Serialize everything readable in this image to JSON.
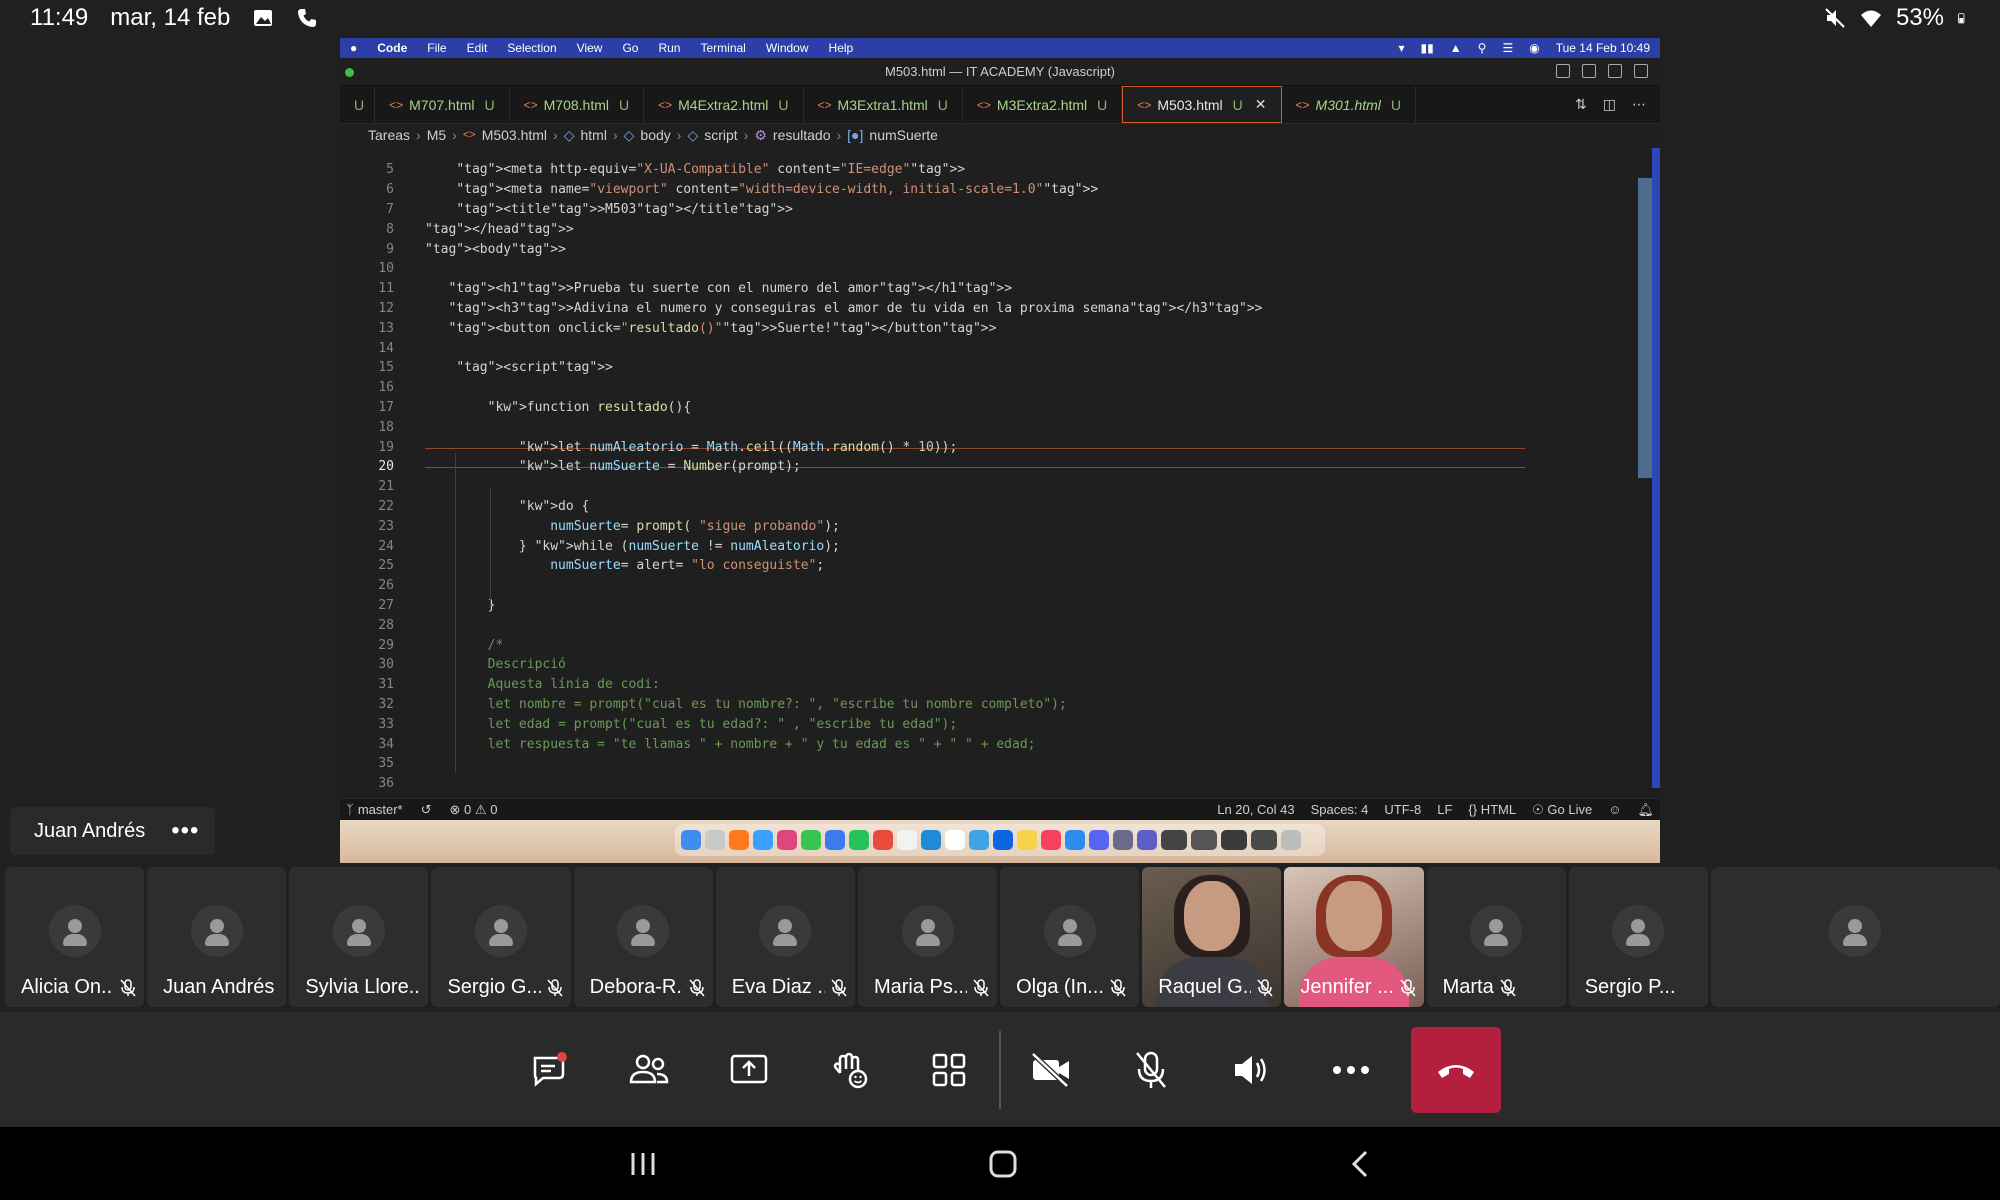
{
  "status_bar": {
    "time": "11:49",
    "date": "mar, 14 feb",
    "battery": "53%"
  },
  "mac": {
    "menu": [
      "Code",
      "File",
      "Edit",
      "Selection",
      "View",
      "Go",
      "Run",
      "Terminal",
      "Window",
      "Help"
    ],
    "datetime": "Tue 14 Feb 10:49"
  },
  "vscode": {
    "window_title": "M503.html — IT ACADEMY (Javascript)",
    "tabs": [
      {
        "label": "U",
        "badge": ""
      },
      {
        "label": "M707.html",
        "badge": "U"
      },
      {
        "label": "M708.html",
        "badge": "U"
      },
      {
        "label": "M4Extra2.html",
        "badge": "U"
      },
      {
        "label": "M3Extra1.html",
        "badge": "U"
      },
      {
        "label": "M3Extra2.html",
        "badge": "U"
      },
      {
        "label": "M503.html",
        "badge": "U"
      },
      {
        "label": "M301.html",
        "badge": "U"
      }
    ],
    "breadcrumb": [
      "Tareas",
      "M5",
      "M503.html",
      "html",
      "body",
      "script",
      "resultado",
      "numSuerte"
    ],
    "status": {
      "branch": "master*",
      "problems": "0",
      "warnings": "0",
      "position": "Ln 20, Col 43",
      "spaces": "Spaces: 4",
      "encoding": "UTF-8",
      "eol": "LF",
      "language": "HTML",
      "golive": "Go Live"
    },
    "line_numbers": [
      "5",
      "6",
      "7",
      "8",
      "9",
      "10",
      "11",
      "12",
      "13",
      "14",
      "15",
      "16",
      "17",
      "18",
      "19",
      "20",
      "21",
      "22",
      "23",
      "24",
      "25",
      "26",
      "27",
      "28",
      "29",
      "30",
      "31",
      "32",
      "33",
      "34",
      "35",
      "36"
    ],
    "code_lines": [
      "    <meta http-equiv=\"X-UA-Compatible\" content=\"IE=edge\">",
      "    <meta name=\"viewport\" content=\"width=device-width, initial-scale=1.0\">",
      "    <title>M503</title>",
      "</head>",
      "<body>",
      "",
      "   <h1>Prueba tu suerte con el numero del amor</h1>",
      "   <h3>Adivina el numero y conseguiras el amor de tu vida en la proxima semana</h3>",
      "   <button onclick=\"resultado()\">Suerte!</button>",
      "",
      "    <script>",
      "",
      "        function resultado(){",
      "",
      "            let numAleatorio = Math.ceil((Math.random() * 10));",
      "            let numSuerte = Number(prompt);",
      "",
      "            do {",
      "                numSuerte= prompt( \"sigue probando\");",
      "            } while (numSuerte != numAleatorio);",
      "                numSuerte= alert= \"lo conseguiste\";",
      "",
      "        }",
      "",
      "        /*",
      "        Descripció",
      "        Aquesta línia de codi:",
      "        let nombre = prompt(\"cual es tu nombre?: \", \"escribe tu nombre completo\");",
      "        let edad = prompt(\"cual es tu edad?: \" , \"escribe tu edad\");",
      "        let respuesta = \"te llamas \" + nombre + \" y tu edad es \" + \" \" + edad;",
      "",
      ""
    ]
  },
  "presenter_chip": {
    "name": "Juan Andrés"
  },
  "participants": [
    {
      "name": "Alicia On...",
      "muted": true,
      "video": false
    },
    {
      "name": "Juan Andrés",
      "muted": false,
      "video": false
    },
    {
      "name": "Sylvia Llore...",
      "muted": false,
      "video": false
    },
    {
      "name": "Sergio G...",
      "muted": true,
      "video": false
    },
    {
      "name": "Debora-R...",
      "muted": true,
      "video": false
    },
    {
      "name": "Eva Diaz ...",
      "muted": true,
      "video": false
    },
    {
      "name": "Maria Ps...",
      "muted": true,
      "video": false
    },
    {
      "name": "Olga  (In...",
      "muted": true,
      "video": false
    },
    {
      "name": "Raquel G...",
      "muted": true,
      "video": true
    },
    {
      "name": "Jennifer ...",
      "muted": true,
      "video": true
    },
    {
      "name": "Marta",
      "muted": true,
      "video": false
    },
    {
      "name": "Sergio P...",
      "muted": false,
      "video": false
    },
    {
      "name": "",
      "muted": false,
      "video": false
    }
  ],
  "colors": {
    "hangup": "#b51f3e",
    "menubar": "#2c3fa6",
    "active_tab_border": "#d35c2a"
  }
}
